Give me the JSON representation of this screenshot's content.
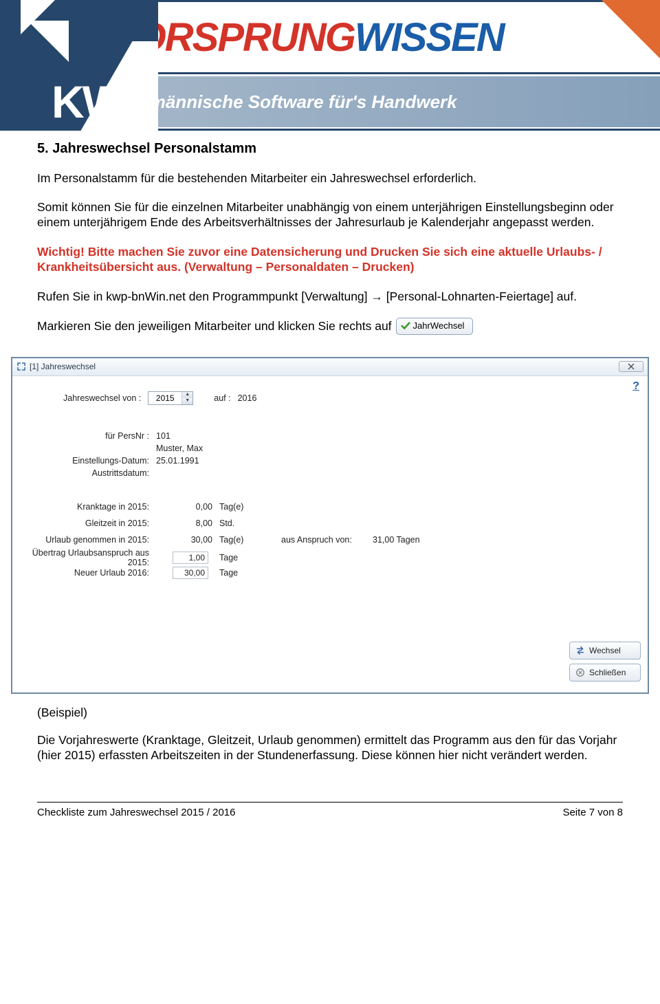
{
  "banner": {
    "logo_text": "KWP",
    "word1": "VORSPRUNG",
    "word2": "WISSEN",
    "subline": "Kaufmännische Software für's Handwerk"
  },
  "heading": "5.  Jahreswechsel Personalstamm",
  "p1": "Im Personalstamm für die bestehenden Mitarbeiter ein Jahreswechsel erforderlich.",
  "p2": "Somit können Sie für die einzelnen Mitarbeiter unabhängig von einem unterjährigen Einstellungsbeginn oder einem unterjährigem Ende des Arbeitsverhältnisses der Jahresurlaub je Kalenderjahr angepasst werden.",
  "warn": "Wichtig! Bitte machen Sie zuvor eine Datensicherung und Drucken Sie sich eine aktuelle Urlaubs- / Krankheitsübersicht aus. (Verwaltung – Personaldaten – Drucken)",
  "p3a": "Rufen Sie in kwp-bnWin.net den Programmpunkt [Verwaltung] ",
  "p3b": " [Personal-Lohnarten-Feiertage] auf.",
  "p4": "Markieren Sie den jeweiligen Mitarbeiter und klicken Sie rechts auf ",
  "inline_button": "JahrWechsel",
  "dialog": {
    "title": "[1] Jahreswechsel",
    "jw_from_label": "Jahreswechsel von :",
    "jw_from_value": "2015",
    "jw_to_label": "auf :",
    "jw_to_value": "2016",
    "persnr_label": "für PersNr :",
    "persnr_value": "101",
    "persname": "Muster, Max",
    "einst_label": "Einstellungs-Datum:",
    "einst_value": "25.01.1991",
    "austr_label": "Austrittsdatum:",
    "austr_value": "",
    "rows": [
      {
        "label": "Kranktage in 2015:",
        "value": "0,00",
        "unit": "Tag(e)",
        "extra_label": "",
        "extra_value": ""
      },
      {
        "label": "Gleitzeit in 2015:",
        "value": "8,00",
        "unit": "Std.",
        "extra_label": "",
        "extra_value": ""
      },
      {
        "label": "Urlaub genommen in 2015:",
        "value": "30,00",
        "unit": "Tag(e)",
        "extra_label": "aus Anspruch von:",
        "extra_value": "31,00  Tagen"
      }
    ],
    "uebertrag_label": "Übertrag Urlaubsanspruch aus 2015:",
    "uebertrag_value": "1,00",
    "uebertrag_unit": "Tage",
    "neuer_label": "Neuer Urlaub 2016:",
    "neuer_value": "30,00",
    "neuer_unit": "Tage",
    "btn_wechsel": "Wechsel",
    "btn_schliessen": "Schließen",
    "help": "?"
  },
  "beispiel": "(Beispiel)",
  "p5": "Die Vorjahreswerte (Kranktage, Gleitzeit, Urlaub genommen) ermittelt das Programm aus den für das Vorjahr (hier 2015) erfassten Arbeitszeiten in der Stundenerfassung. Diese können hier nicht verändert werden.",
  "footer_left": "Checkliste zum Jahreswechsel 2015 / 2016",
  "footer_right": "Seite 7 von 8"
}
